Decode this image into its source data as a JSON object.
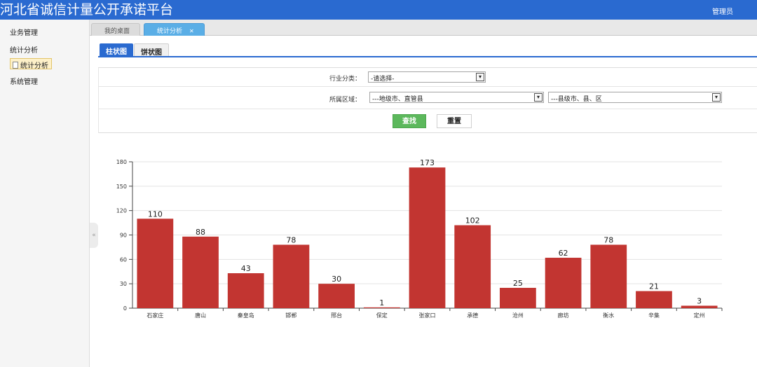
{
  "header": {
    "title": "河北省诚信计量公开承诺平台",
    "user": "管理员"
  },
  "sidebar": {
    "items": [
      {
        "label": "业务管理"
      },
      {
        "label": "统计分析"
      },
      {
        "label": "统计分析",
        "selected": true
      },
      {
        "label": "系统管理"
      }
    ]
  },
  "tabs": [
    {
      "label": "我的桌面"
    },
    {
      "label": "统计分析",
      "active": true
    }
  ],
  "chart_tabs": [
    {
      "label": "柱状图",
      "active": true
    },
    {
      "label": "饼状图"
    }
  ],
  "filters": {
    "industry": {
      "label": "行业分类：",
      "value": "-请选择-"
    },
    "region": {
      "label": "所属区域：",
      "city": "---地级市、直管县",
      "county": "---县级市、县、区"
    }
  },
  "buttons": {
    "search": "查找",
    "reset": "重置"
  },
  "colors": {
    "header": "#2a6ad0",
    "bar": "#c23531",
    "active_tab": "#5aaee6",
    "search_button": "#5cb85c"
  },
  "chart_data": {
    "type": "bar",
    "categories": [
      "石家庄",
      "唐山",
      "秦皇岛",
      "邯郸",
      "邢台",
      "保定",
      "张家口",
      "承德",
      "沧州",
      "廊坊",
      "衡水",
      "辛集",
      "定州"
    ],
    "values": [
      110,
      88,
      43,
      78,
      30,
      1,
      173,
      102,
      25,
      62,
      78,
      21,
      3
    ],
    "ylim": [
      0,
      180
    ],
    "yticks": [
      0,
      30,
      60,
      90,
      120,
      150,
      180
    ],
    "grid": true,
    "data_labels": true
  }
}
